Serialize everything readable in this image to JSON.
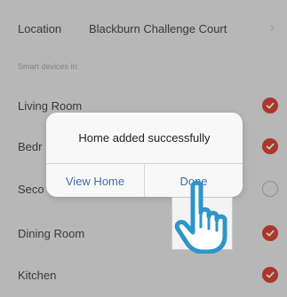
{
  "location": {
    "label": "Location",
    "value": "Blackburn Challenge Court",
    "icon": "chevron-right-icon"
  },
  "section_header": "Smart devices in:",
  "rooms": [
    {
      "label": "Living Room",
      "checked": true
    },
    {
      "label": "Bedr",
      "checked": true
    },
    {
      "label": "Seco",
      "checked": false
    },
    {
      "label": "Dining Room",
      "checked": true
    },
    {
      "label": "Kitchen",
      "checked": true
    }
  ],
  "dialog": {
    "title": "Home added successfully",
    "view_home_label": "View Home",
    "done_label": "Done"
  },
  "colors": {
    "accent": "#d9473a",
    "link": "#3f6cb1",
    "background": "#ebebeb"
  },
  "icons": {
    "check": "check-icon",
    "pointer": "pointing-hand-icon"
  }
}
